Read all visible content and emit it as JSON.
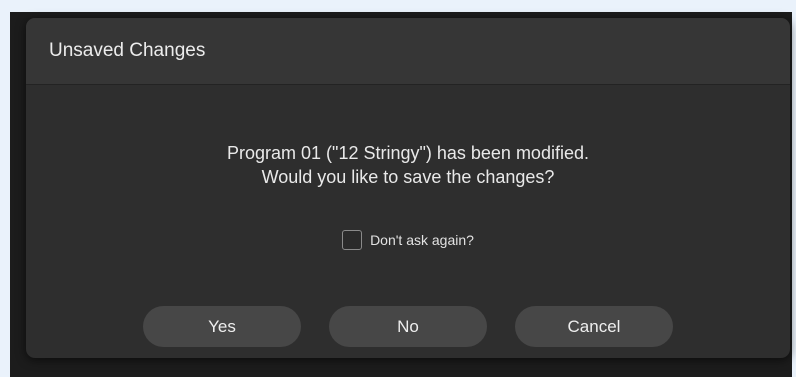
{
  "dialog": {
    "title": "Unsaved Changes",
    "message_line1": "Program 01 (\"12 Stringy\") has been modified.",
    "message_line2": "Would you like to save the changes?",
    "dont_ask_again_label": "Don't ask again?",
    "dont_ask_again_checked": false,
    "buttons": {
      "yes": "Yes",
      "no": "No",
      "cancel": "Cancel"
    }
  },
  "colors": {
    "dialog_background": "#2e2e2e",
    "header_background": "#363636",
    "button_background": "#474747",
    "text": "#e9e9e9"
  }
}
